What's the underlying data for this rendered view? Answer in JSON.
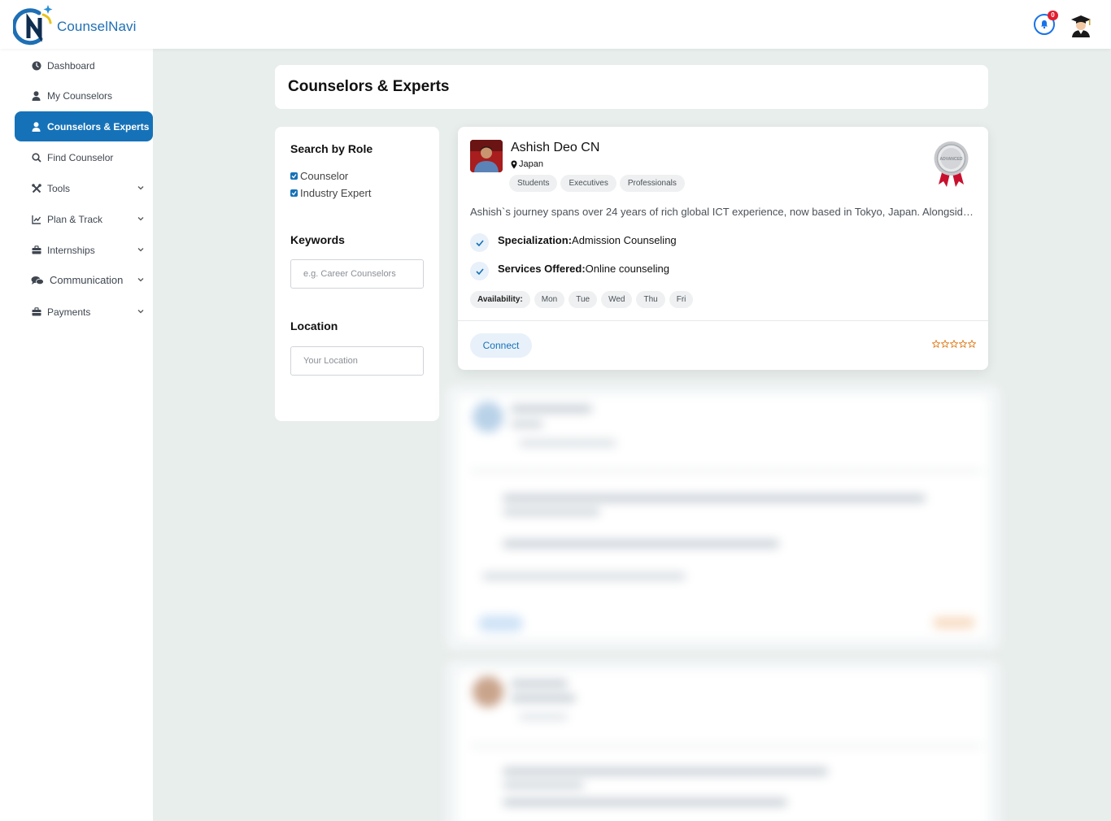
{
  "app": {
    "brand": "CounselNavi",
    "notification_count": "0"
  },
  "sidebar": {
    "items": [
      {
        "label": "Dashboard",
        "icon": "dashboard-icon"
      },
      {
        "label": "My Counselors",
        "icon": "user-icon"
      },
      {
        "label": "Counselors & Experts",
        "icon": "user-icon",
        "active": true
      },
      {
        "label": "Find Counselor",
        "icon": "search-icon"
      },
      {
        "label": "Tools",
        "icon": "tools-icon",
        "expandable": true
      },
      {
        "label": "Plan & Track",
        "icon": "chart-icon",
        "expandable": true
      },
      {
        "label": "Internships",
        "icon": "briefcase-icon",
        "expandable": true
      },
      {
        "label": "Communication",
        "icon": "comments-icon",
        "expandable": true
      },
      {
        "label": "Payments",
        "icon": "briefcase-icon",
        "expandable": true
      }
    ]
  },
  "page": {
    "title": "Counselors & Experts"
  },
  "filters": {
    "role_title": "Search by Role",
    "roles": [
      {
        "label": "Counselor",
        "checked": true
      },
      {
        "label": "Industry Expert",
        "checked": true
      }
    ],
    "keywords_title": "Keywords",
    "keywords_placeholder": "e.g. Career Counselors",
    "location_title": "Location",
    "location_placeholder": "Your Location"
  },
  "counselor": {
    "name": "Ashish Deo CN",
    "location": "Japan",
    "tags": [
      "Students",
      "Executives",
      "Professionals"
    ],
    "badge": "ADVANCED",
    "description": "Ashish`s journey spans over 24 years of rich global ICT experience, now based in Tokyo, Japan. Alongside his ...",
    "specialization_label": "Specialization:",
    "specialization_value": "Admission Counseling",
    "services_label": "Services Offered:",
    "services_value": "Online counseling",
    "availability_label": "Availability:",
    "days": [
      "Mon",
      "Tue",
      "Wed",
      "Thu",
      "Fri"
    ],
    "connect_label": "Connect",
    "rating": 0,
    "max_rating": 5
  },
  "colors": {
    "primary": "#1672b8",
    "star": "#e07b1a",
    "badge_red": "#e11d2e"
  }
}
